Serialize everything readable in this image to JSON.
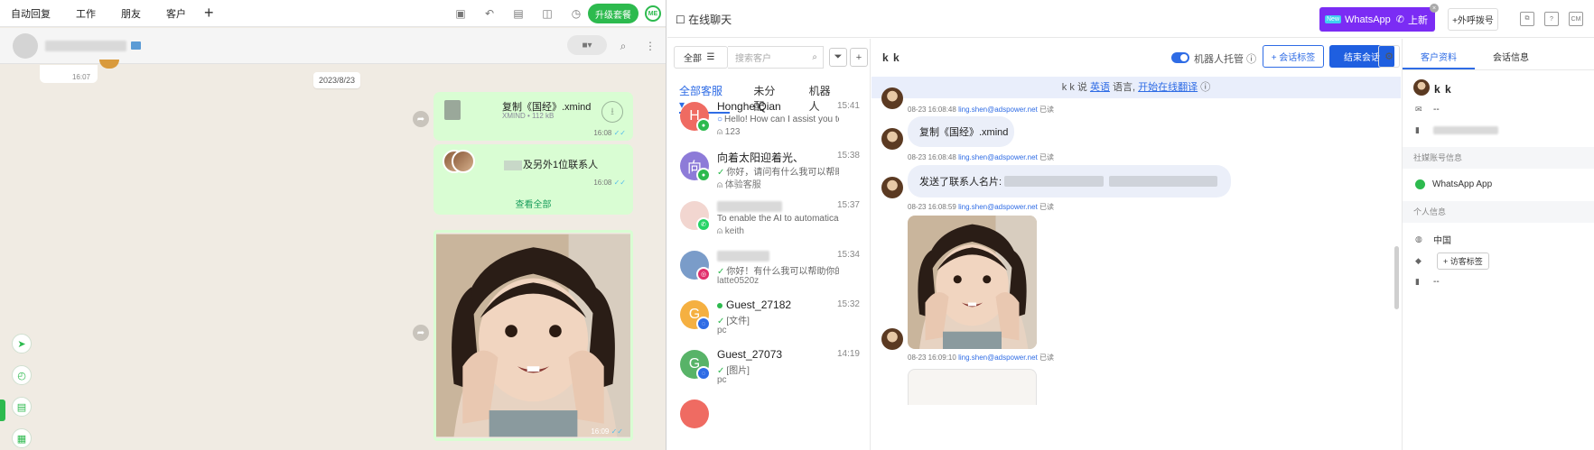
{
  "left_app": {
    "nav": [
      "自动回复",
      "工作",
      "朋友",
      "客户"
    ],
    "upgrade_label": "升级套餐",
    "me_badge": "ME",
    "date_separator": "2023/8/23",
    "prev_time": "16:07",
    "file_message": {
      "name": "复制《国经》.xmind",
      "meta": "XMIND • 112 kB",
      "time": "16:08"
    },
    "contact_message": {
      "text": "及另外1位联系人",
      "time": "16:08",
      "view_all": "查看全部"
    },
    "photo_time": "16:09"
  },
  "right_app": {
    "title": "在线聊天",
    "whatsapp_badge": {
      "new": "New",
      "text": "WhatsApp",
      "up": "上新"
    },
    "outbound_call": "+外呼拨号",
    "filter": {
      "all": "全部",
      "search_placeholder": "搜索客户"
    },
    "service_tabs": [
      "全部客服",
      "未分配",
      "机器人"
    ],
    "conversations": [
      {
        "initial": "H",
        "name": "Honghe Qian",
        "time": "15:41",
        "preview": "Hello! How can I assist you to",
        "sub": "123",
        "color": "#ef6b62",
        "channel_color": "#2dba4e"
      },
      {
        "initial": "向",
        "name": "向着太阳迎着光、",
        "time": "15:38",
        "preview": "你好，请问有什么我可以帮助...",
        "sub": "体验客服",
        "color": "#8d7bd8",
        "channel_color": "#2dba4e"
      },
      {
        "initial": "",
        "name": "",
        "time": "15:37",
        "preview": "To enable the AI to automatica",
        "sub": "keith",
        "color": "#f2d6d0",
        "channel_color": "#25d366"
      },
      {
        "initial": "",
        "name": "",
        "time": "15:34",
        "preview": "你好！有什么我可以帮助你的...",
        "sub": "latte0520z",
        "color": "#7a9cc9",
        "channel_color": "#e1306c"
      },
      {
        "initial": "G",
        "name": "Guest_27182",
        "time": "15:32",
        "preview": "[文件]",
        "sub": "pc",
        "color": "#f5b041",
        "channel_color": "#2f6ce5"
      },
      {
        "initial": "G",
        "name": "Guest_27073",
        "time": "14:19",
        "preview": "[图片]",
        "sub": "pc",
        "color": "#58b368",
        "channel_color": "#2f6ce5"
      }
    ],
    "chat": {
      "name": "k k",
      "robot_label": "机器人托管",
      "tag_button": "+ 会话标签",
      "end_button": "结束会话",
      "translate_bar": {
        "pre": "k k 说 ",
        "lang": "英语",
        "mid": " 语言, ",
        "link": "开始在线翻译"
      },
      "messages": [
        {
          "time": "08-23 16:08:48",
          "agent": "ling.shen@adspower.net",
          "status": "已读"
        },
        {
          "text": "复制《国经》.xmind",
          "time": "08-23 16:08:48",
          "agent": "ling.shen@adspower.net",
          "status": "已读"
        },
        {
          "text": "发送了联系人名片:",
          "time": "08-23 16:08:59",
          "agent": "ling.shen@adspower.net",
          "status": "已读"
        },
        {
          "time": "08-23 16:09:10",
          "agent": "ling.shen@adspower.net",
          "status": "已读"
        }
      ]
    },
    "info": {
      "tabs": [
        "客户资料",
        "会话信息"
      ],
      "name": "k k",
      "email": "--",
      "social_section": "社媒账号信息",
      "whatsapp": "WhatsApp App",
      "personal_section": "个人信息",
      "country": "中国",
      "visitor_tag": "+ 访客标签",
      "note": "--"
    }
  }
}
